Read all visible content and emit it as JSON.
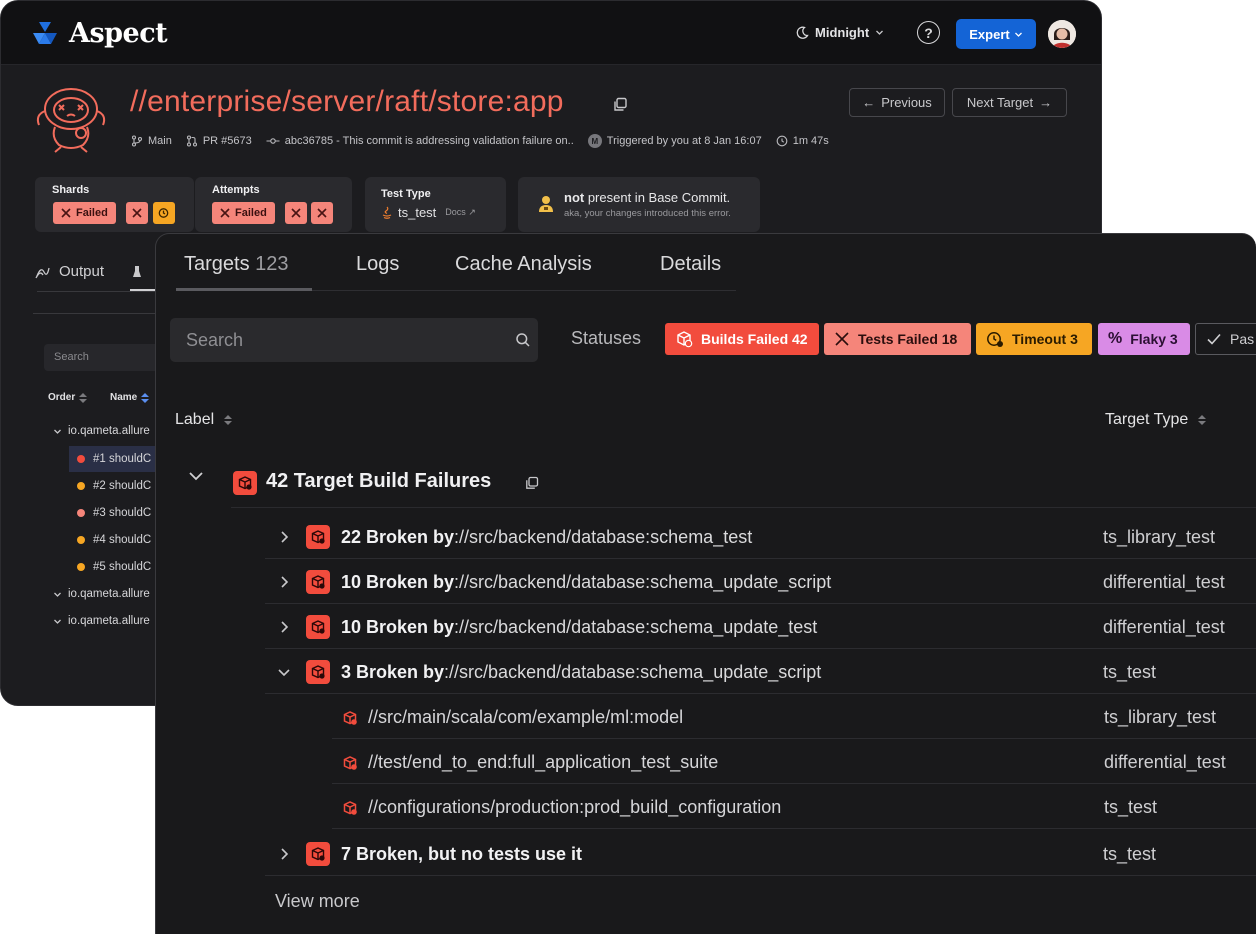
{
  "app": {
    "name": "Aspect"
  },
  "header": {
    "theme_label": "Midnight",
    "help_label": "?",
    "mode_label": "Expert"
  },
  "target": {
    "title": "//enterprise/server/raft/store:app",
    "prev_label": "Previous",
    "next_label": "Next Target",
    "branch": "Main",
    "pr": "PR #5673",
    "commit": "abc36785 - This commit is addressing validation failure on..",
    "trigger_badge": "M",
    "triggered": "Triggered by you at 8 Jan 16:07",
    "duration": "1m 47s"
  },
  "summary_cards": {
    "shards": {
      "label": "Shards",
      "status": "Failed"
    },
    "attempts": {
      "label": "Attempts",
      "status": "Failed"
    },
    "test_type": {
      "label": "Test Type",
      "value": "ts_test",
      "docs": "Docs"
    },
    "base_commit": {
      "bold": "not",
      "rest": " present in Base Commit.",
      "sub": "aka, your changes introduced this error."
    }
  },
  "left_panel": {
    "output_tab": "Output",
    "search_placeholder": "Search",
    "col_order": "Order",
    "col_name": "Name",
    "tree": [
      {
        "label": "io.qameta.allure"
      },
      {
        "label": "io.qameta.allure"
      },
      {
        "label": "io.qameta.allure"
      }
    ],
    "children": [
      {
        "label": "#1 shouldC",
        "color": "#f24c3d"
      },
      {
        "label": "#2 shouldC",
        "color": "#f6a623"
      },
      {
        "label": "#3 shouldC",
        "color": "#f5857a"
      },
      {
        "label": "#4 shouldC",
        "color": "#f6a623"
      },
      {
        "label": "#5 shouldC",
        "color": "#f6a623"
      }
    ]
  },
  "main": {
    "tabs": [
      {
        "label": "Targets",
        "count": "123"
      },
      {
        "label": "Logs"
      },
      {
        "label": "Cache Analysis"
      },
      {
        "label": "Details"
      }
    ],
    "search_placeholder": "Search",
    "statuses_label": "Statuses",
    "status_chips": {
      "builds_failed": "Builds Failed 42",
      "tests_failed": "Tests Failed 18",
      "timeout": "Timeout 3",
      "flaky": "Flaky 3",
      "passed": "Pas"
    },
    "columns": {
      "label": "Label",
      "target_type": "Target Type"
    },
    "group_label": "42 Target Build Failures",
    "rows": [
      {
        "bold": "22 Broken by",
        "path": "://src/backend/database:schema_test",
        "type": "ts_library_test"
      },
      {
        "bold": "10 Broken by",
        "path": "://src/backend/database:schema_update_script",
        "type": "differential_test"
      },
      {
        "bold": "10 Broken by",
        "path": "://src/backend/database:schema_update_test",
        "type": "differential_test"
      },
      {
        "bold": "3 Broken by",
        "path": "://src/backend/database:schema_update_script",
        "type": "ts_test"
      }
    ],
    "subrows": [
      {
        "path": "//src/main/scala/com/example/ml:model",
        "type": "ts_library_test"
      },
      {
        "path": "//test/end_to_end:full_application_test_suite",
        "type": "differential_test"
      },
      {
        "path": "//configurations/production:prod_build_configuration",
        "type": "ts_test"
      }
    ],
    "last_row": {
      "bold": "7 Broken, but no tests use it",
      "type": "ts_test"
    },
    "view_more": "View more"
  },
  "colors": {
    "error_red": "#f24c3d",
    "failed_salmon": "#f5857a",
    "timeout_orange": "#f6a623",
    "flaky_purple": "#d98be6",
    "brand_blue": "#1464d6"
  }
}
